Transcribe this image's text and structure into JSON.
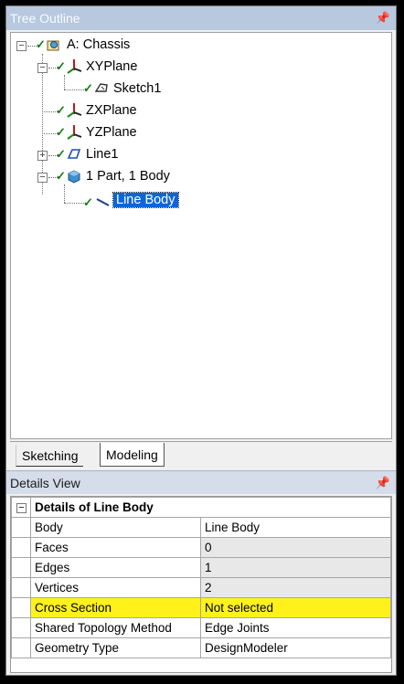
{
  "tree_panel": {
    "title": "Tree Outline",
    "pin_icon": "pin-icon",
    "nodes": {
      "root": "A: Chassis",
      "xyplane": "XYPlane",
      "sketch1": "Sketch1",
      "zxplane": "ZXPlane",
      "yzplane": "YZPlane",
      "line1": "Line1",
      "part": "1 Part, 1 Body",
      "linebody": "Line Body"
    },
    "selected": "Line Body"
  },
  "tabs": {
    "sketching": "Sketching",
    "modeling": "Modeling",
    "active": "Modeling"
  },
  "details_panel": {
    "title": "Details View",
    "group_title": "Details of Line Body",
    "rows": [
      {
        "name": "Body",
        "value": "Line Body"
      },
      {
        "name": "Faces",
        "value": "0"
      },
      {
        "name": "Edges",
        "value": "1"
      },
      {
        "name": "Vertices",
        "value": "2"
      },
      {
        "name": "Cross Section",
        "value": "Not selected"
      },
      {
        "name": "Shared Topology Method",
        "value": "Edge Joints"
      },
      {
        "name": "Geometry Type",
        "value": "DesignModeler"
      }
    ]
  },
  "colors": {
    "selection": "#0f65d8",
    "warning_highlight": "#fff21a",
    "check": "#157a15"
  }
}
